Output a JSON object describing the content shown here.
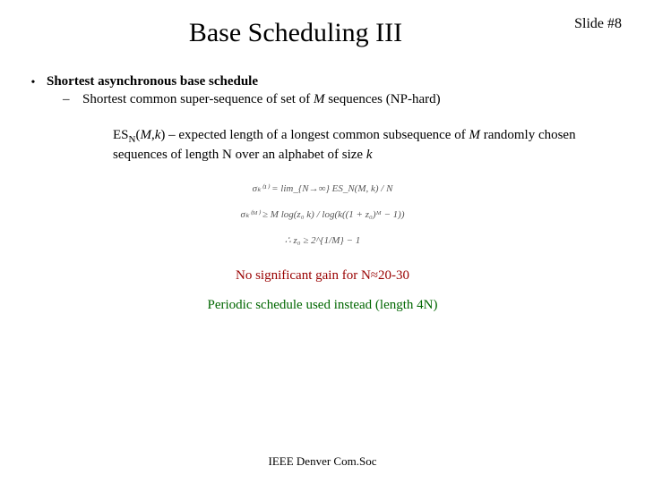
{
  "slide_number": "Slide #8",
  "title": "Base Scheduling III",
  "bullet1": {
    "heading": "Shortest asynchronous base schedule",
    "sub_prefix": "Shortest common super-sequence of set of ",
    "sub_M": "M",
    "sub_suffix": " sequences (NP-hard)"
  },
  "esn": {
    "prefix": "ES",
    "sub": "N",
    "args_open": "(",
    "arg1": "M",
    "sep": ",",
    "arg2": "k",
    "args_close": ") – expected length of a longest common subsequence of ",
    "randM": "M",
    "rand_suffix": " randomly chosen sequences of length N over an alphabet of size ",
    "k": "k"
  },
  "formula": {
    "line1": "σₖ⁽¹⁾ = lim_{N→∞} ES_N(M, k) / N",
    "line2": "σₖ⁽ᴹ⁾ ≥ M log(z₀ k) / log(k((1 + z₀)ᴹ − 1))",
    "line3": "∴  z₀ ≥ 2^{1/M} − 1"
  },
  "gain_text": "No significant gain for N≈20-30",
  "periodic_text": "Periodic schedule used instead (length 4N)",
  "footer": "IEEE Denver Com.Soc"
}
